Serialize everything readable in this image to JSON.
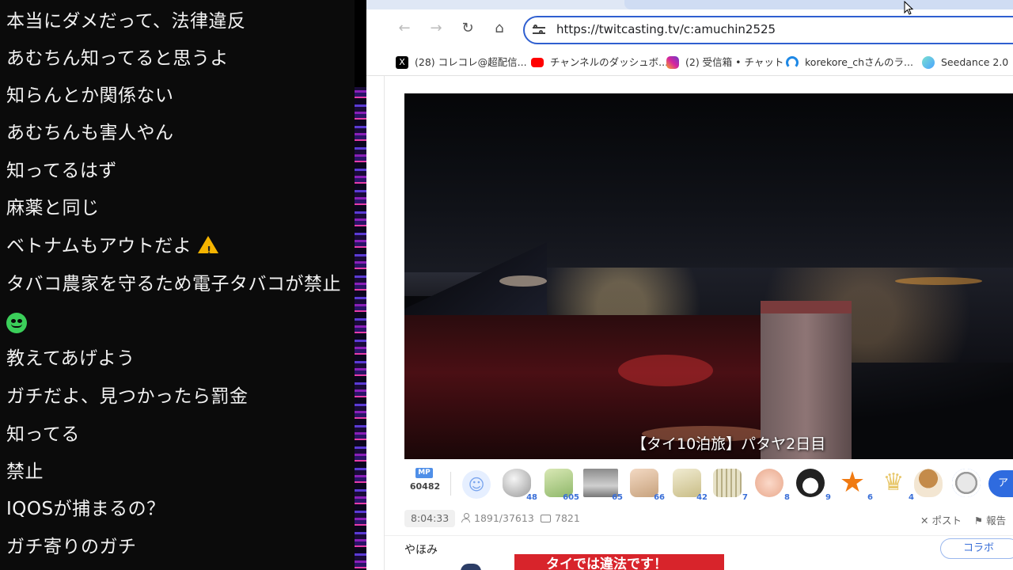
{
  "comments": [
    {
      "text": "本当にダメだって、法律違反"
    },
    {
      "text": "あむちん知ってると思うよ"
    },
    {
      "text": "知らんとか関係ない"
    },
    {
      "text": "あむちんも害人やん"
    },
    {
      "text": "知ってるはず"
    },
    {
      "text": "麻薬と同じ"
    },
    {
      "text": "ベトナムもアウトだよ"
    },
    {
      "text": "タバコ農家を守るため電子タバコが禁止"
    },
    {
      "text": ""
    },
    {
      "text": "教えてあげよう"
    },
    {
      "text": "ガチだよ、見つかったら罰金"
    },
    {
      "text": "知ってる"
    },
    {
      "text": "禁止"
    },
    {
      "text": "IQOSが捕まるの？"
    },
    {
      "text": "ガチ寄りのガチ"
    }
  ],
  "browser": {
    "url": "https://twitcasting.tv/c:amuchin2525",
    "nav": {
      "back": "←",
      "forward": "→",
      "reload": "↻",
      "home": "⌂"
    },
    "bookmarks": [
      {
        "label": "(28) コレコレ@超配信...",
        "icon": "x-icon",
        "color": "#000000"
      },
      {
        "label": "チャンネルのダッシュボ...",
        "icon": "youtube-icon",
        "color": "#ff0000"
      },
      {
        "label": "(2) 受信箱 • チャット",
        "icon": "instagram-icon",
        "color": "#d6249f"
      },
      {
        "label": "korekore_chさんのラ...",
        "icon": "headset-icon",
        "color": "#1e88e5"
      },
      {
        "label": "Seedance 2.0",
        "icon": "seedance-icon",
        "color": "#4aa3ff"
      }
    ]
  },
  "stream": {
    "subtitle": "【タイ10泊旅】パタヤ2日目",
    "mp_badge": "MP",
    "mp_points": "60482",
    "gifts": [
      {
        "name": "coin-gift-icon",
        "count": "48"
      },
      {
        "name": "tea-gift-icon",
        "count": "605"
      },
      {
        "name": "cat-gift-icon",
        "count": "65"
      },
      {
        "name": "tea-gift-icon",
        "count": "66"
      },
      {
        "name": "tea-gift-icon",
        "count": "42"
      },
      {
        "name": "tea-gift-icon",
        "count": "7"
      },
      {
        "name": "clap-gift-icon",
        "count": "8"
      },
      {
        "name": "penguin-gift-icon",
        "count": "9"
      },
      {
        "name": "star-gift-icon",
        "count": "6"
      },
      {
        "name": "crown-gift-icon",
        "count": "4"
      },
      {
        "name": "mushroom-gift-icon",
        "count": ""
      },
      {
        "name": "coin-gift-icon",
        "count": ""
      }
    ],
    "ai_button": "ア",
    "elapsed": "8:04:33",
    "viewers": "1891/37613",
    "comments_count": "7821",
    "post_label": "ポスト",
    "report_label": "報告",
    "channel_name": "やほみ",
    "collab_label": "コラボ",
    "banner_text": "タイでは違法です！"
  },
  "colors": {
    "accent": "#2f6bdf",
    "banner": "#d8242b",
    "address_border": "#2f5fd0"
  }
}
